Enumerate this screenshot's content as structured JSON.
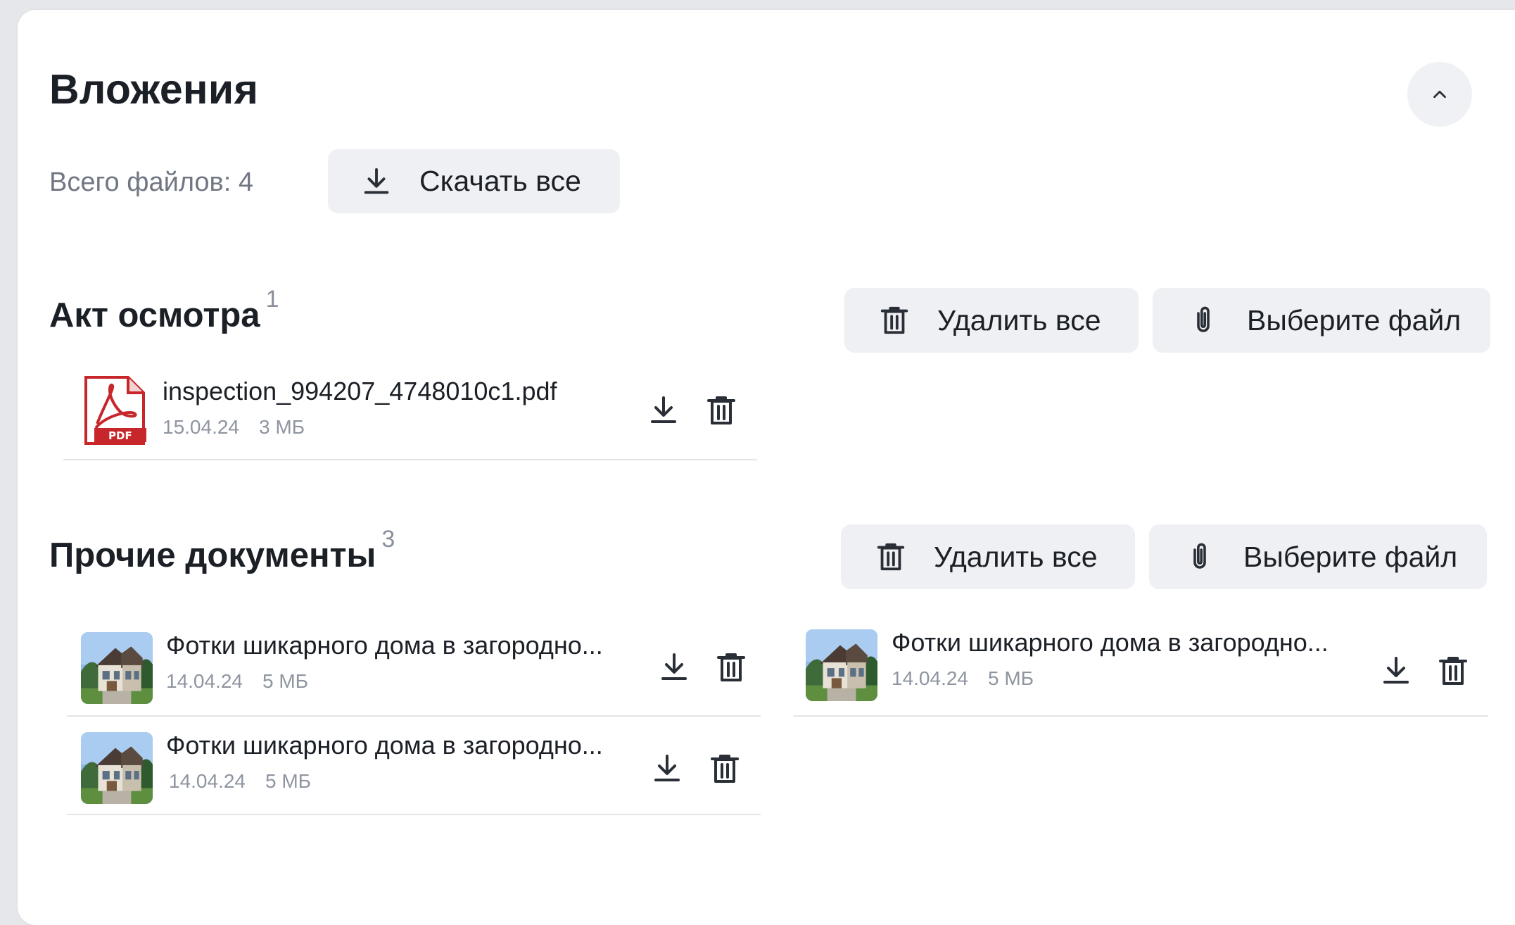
{
  "attachments": {
    "title": "Вложения",
    "total_label": "Всего файлов: 4",
    "download_all_label": "Скачать все"
  },
  "sections": [
    {
      "title": "Акт осмотра",
      "count": "1",
      "delete_all_label": "Удалить все",
      "choose_file_label": "Выберите файл",
      "files": [
        {
          "name": "inspection_994207_4748010c1.pdf",
          "date": "15.04.24",
          "size": "3 МБ",
          "type": "pdf-icon"
        }
      ]
    },
    {
      "title": "Прочие документы",
      "count": "3",
      "delete_all_label": "Удалить все",
      "choose_file_label": "Выберите файл",
      "files": [
        {
          "name": "Фотки шикарного дома в загородно...",
          "date": "14.04.24",
          "size": "5 МБ",
          "type": "image-thumbnail"
        },
        {
          "name": "Фотки шикарного дома в загородно...",
          "date": "14.04.24",
          "size": "5 МБ",
          "type": "image-thumbnail"
        },
        {
          "name": "Фотки шикарного дома в загородно...",
          "date": "14.04.24",
          "size": "5 МБ",
          "type": "image-thumbnail"
        }
      ]
    }
  ],
  "colors": {
    "page_background": "#e6e7ea",
    "card": "#ffffff",
    "button_background": "#eff0f3",
    "muted_text": "#707783",
    "pdf_red": "#d42b2b"
  },
  "icons": [
    "chevron-up-icon",
    "download-icon",
    "trash-icon",
    "paperclip-icon",
    "pdf-icon"
  ]
}
